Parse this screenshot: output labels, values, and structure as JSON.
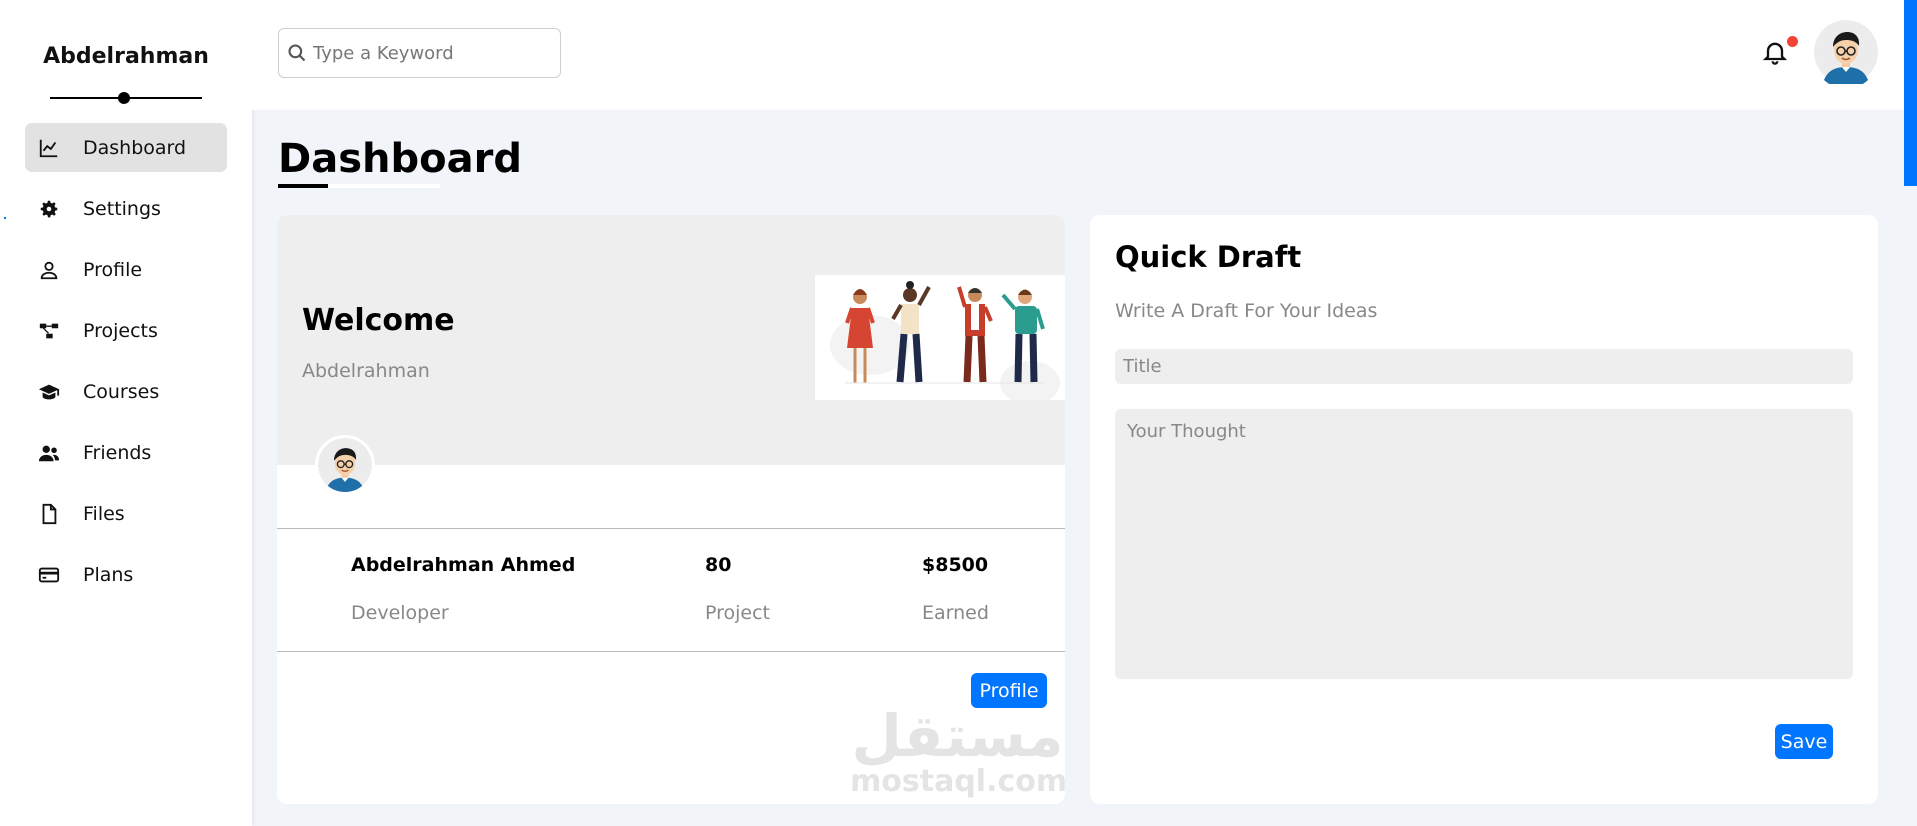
{
  "sidebar": {
    "brand": "Abdelrahman",
    "items": [
      {
        "label": "Dashboard",
        "icon": "chart-line-icon",
        "active": true
      },
      {
        "label": "Settings",
        "icon": "gear-icon",
        "active": false
      },
      {
        "label": "Profile",
        "icon": "user-icon",
        "active": false
      },
      {
        "label": "Projects",
        "icon": "diagram-project-icon",
        "active": false
      },
      {
        "label": "Courses",
        "icon": "graduation-cap-icon",
        "active": false
      },
      {
        "label": "Friends",
        "icon": "users-icon",
        "active": false
      },
      {
        "label": "Files",
        "icon": "file-icon",
        "active": false
      },
      {
        "label": "Plans",
        "icon": "credit-card-icon",
        "active": false
      }
    ]
  },
  "header": {
    "search_placeholder": "Type a Keyword",
    "notification_icon": "bell-icon",
    "has_notification": true
  },
  "page": {
    "title": "Dashboard"
  },
  "welcome": {
    "title": "Welcome",
    "subtitle": "Abdelrahman",
    "stats": [
      {
        "value": "Abdelrahman Ahmed",
        "label": "Developer"
      },
      {
        "value": "80",
        "label": "Project"
      },
      {
        "value": "$8500",
        "label": "Earned"
      }
    ],
    "button_label": "Profile"
  },
  "draft": {
    "title": "Quick Draft",
    "subtitle": "Write A Draft For Your Ideas",
    "title_placeholder": "Title",
    "body_placeholder": "Your Thought",
    "button_label": "Save"
  },
  "watermark": {
    "arabic": "مستقل",
    "latin": "mostaql.com"
  },
  "colors": {
    "accent": "#0075ff",
    "notification_dot": "#f44336",
    "page_bg": "#f1f5f9"
  }
}
